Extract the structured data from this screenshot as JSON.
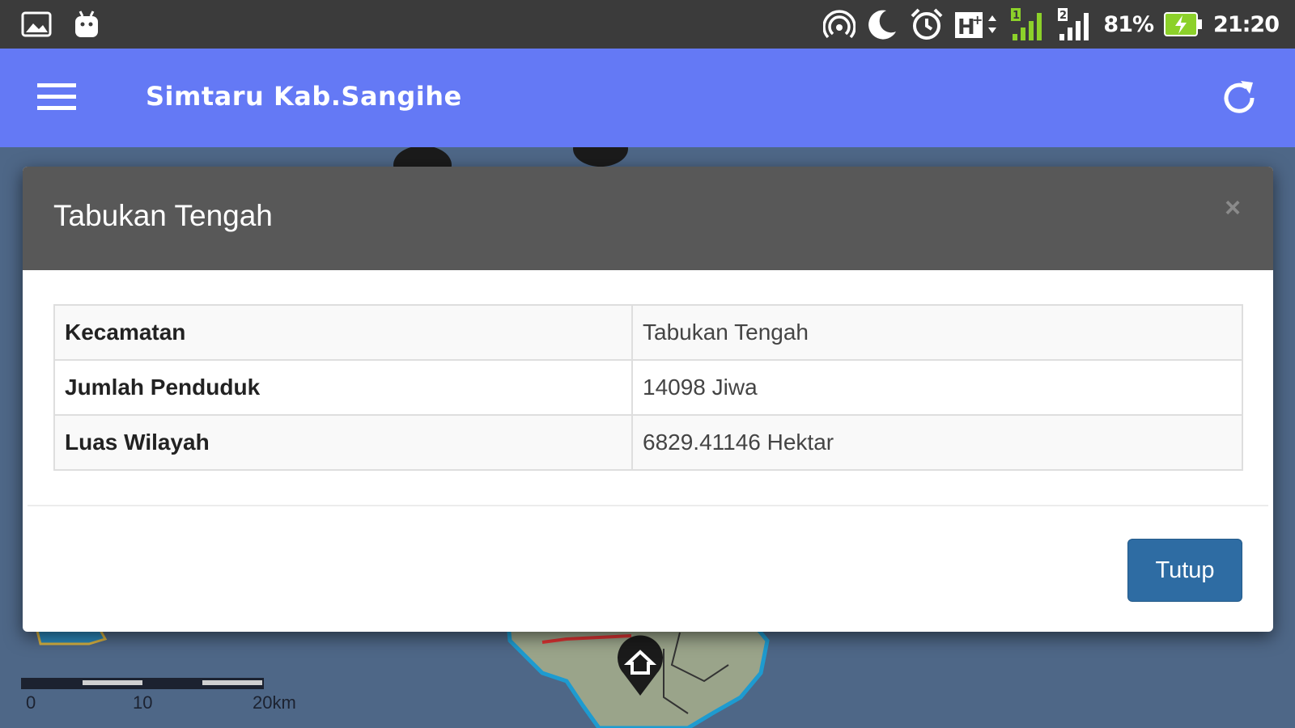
{
  "status_bar": {
    "left_icons": [
      "image-icon",
      "android-icon"
    ],
    "right_icons": [
      "hotspot-icon",
      "moon-icon",
      "alarm-icon",
      "hplus-icon",
      "signal-sim1-icon",
      "signal-sim2-icon",
      "battery-charging-icon"
    ],
    "battery_percent": "81%",
    "time": "21:20"
  },
  "app_bar": {
    "title": "Simtaru Kab.Sangihe",
    "menu_icon": "hamburger-menu-icon",
    "refresh_icon": "refresh-icon",
    "color": "#6479f5"
  },
  "map": {
    "scale_labels": [
      "0",
      "10",
      "20km"
    ],
    "markers": [
      "map-marker-icon",
      "map-marker-icon",
      "home-marker-icon"
    ]
  },
  "modal": {
    "title": "Tabukan Tengah",
    "close_symbol": "×",
    "rows": [
      {
        "label": "Kecamatan",
        "value": "Tabukan Tengah"
      },
      {
        "label": "Jumlah Penduduk",
        "value": "14098 Jiwa"
      },
      {
        "label": "Luas Wilayah",
        "value": "6829.41146 Hektar"
      }
    ],
    "close_button_label": "Tutup",
    "button_color": "#2e6ca3",
    "header_color": "#585858"
  }
}
